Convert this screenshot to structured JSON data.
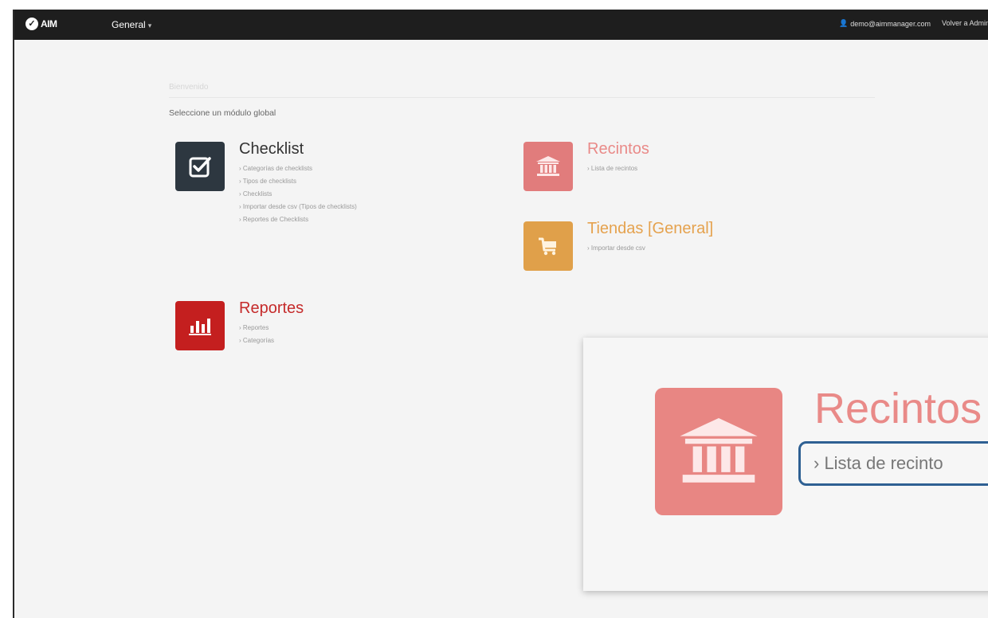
{
  "navbar": {
    "brand": "AIM",
    "menu": "General",
    "user_email": "demo@aimmanager.com",
    "back_link": "Volver a Admin"
  },
  "page": {
    "breadcrumb": "Bienvenido",
    "subtitle": "Seleccione un módulo global"
  },
  "modules": {
    "checklist": {
      "title": "Checklist",
      "color": "#2d3740",
      "links": [
        "› Categorías de checklists",
        "› Tipos de checklists",
        "› Checklists",
        "› Importar desde csv (Tipos de checklists)",
        "› Reportes de Checklists"
      ]
    },
    "recintos": {
      "title": "Recintos",
      "color": "#e17c7c",
      "links": [
        "› Lista de recintos"
      ]
    },
    "tiendas": {
      "title": "Tiendas [General]",
      "color": "#e0a04a",
      "links": [
        "› Importar desde csv"
      ]
    },
    "reportes": {
      "title": "Reportes",
      "color": "#c41f1f",
      "links": [
        "› Reportes",
        "› Categorías"
      ]
    }
  },
  "zoom": {
    "title": "Recintos",
    "link": "› Lista de recinto"
  }
}
